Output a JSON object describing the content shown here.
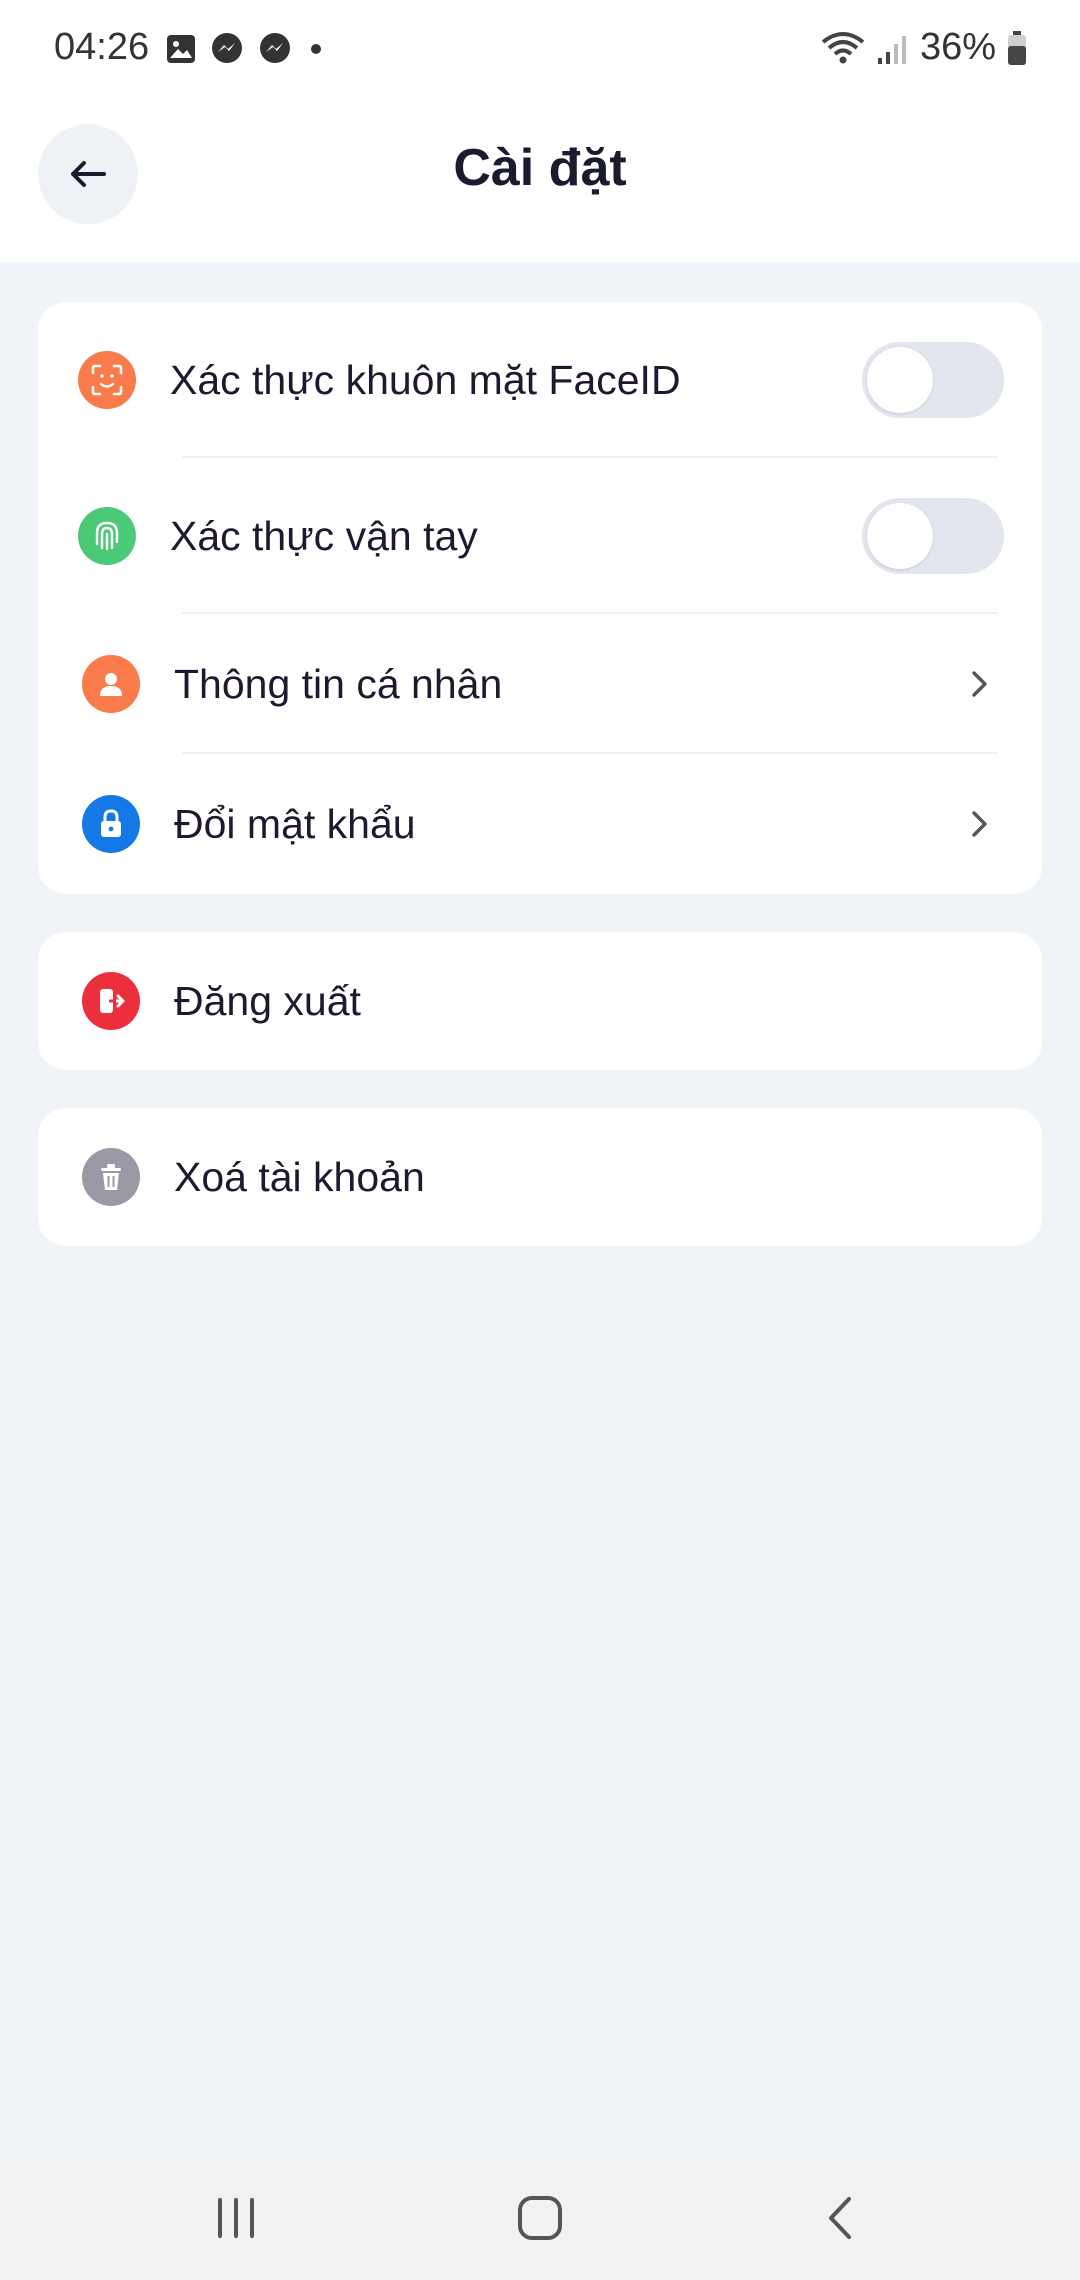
{
  "status_bar": {
    "time": "04:26",
    "battery": "36%",
    "left_icons": [
      "gallery-icon",
      "messenger-icon",
      "messenger-icon",
      "dot-icon"
    ],
    "right_icons": [
      "wifi-icon",
      "signal-icon",
      "battery-icon"
    ]
  },
  "header": {
    "title": "Cài đặt",
    "back_icon": "arrow-left-icon"
  },
  "security_card": {
    "items": [
      {
        "label": "Xác thực khuôn mặt FaceID",
        "icon": "face-id-icon",
        "control": "toggle",
        "enabled": false,
        "color": "#F97B4B"
      },
      {
        "label": "Xác thực vận tay",
        "icon": "fingerprint-icon",
        "control": "toggle",
        "enabled": false,
        "color": "#4CC977"
      },
      {
        "label": "Thông tin cá nhân",
        "icon": "user-icon",
        "control": "chevron",
        "color": "#F97B4B"
      },
      {
        "label": "Đổi mật khẩu",
        "icon": "lock-icon",
        "control": "chevron",
        "color": "#1479E6"
      }
    ]
  },
  "logout": {
    "label": "Đăng xuất",
    "icon": "logout-icon",
    "color": "#EC2F3C"
  },
  "delete_account": {
    "label": "Xoá tài khoản",
    "icon": "trash-icon",
    "color": "#9A9AA6"
  },
  "nav_bar": {
    "buttons": [
      "recent-apps-icon",
      "home-icon",
      "back-icon"
    ]
  }
}
